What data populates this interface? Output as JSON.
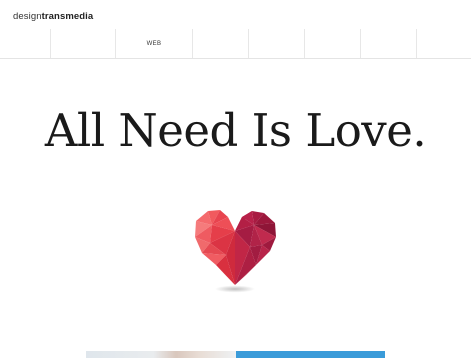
{
  "brand": {
    "light": "design",
    "bold": "transmedia"
  },
  "nav": {
    "items": [
      "",
      "WEB",
      "",
      "",
      "",
      "",
      ""
    ]
  },
  "hero": {
    "headline": "All Need Is Love."
  },
  "colors": {
    "heart_light": "#f25b5f",
    "heart_dark": "#b31f45",
    "accent_blue": "#3a9bd9"
  },
  "icons": {
    "hero": "heart-icon"
  }
}
